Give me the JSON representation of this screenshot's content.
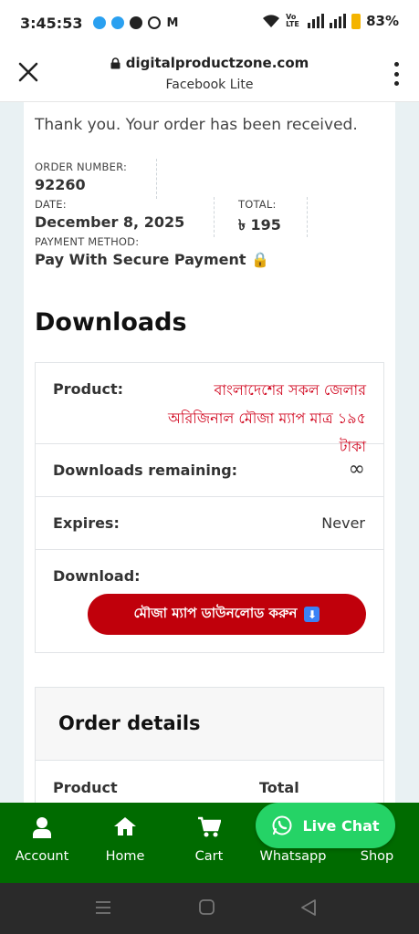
{
  "status_bar": {
    "time": "3:45:53",
    "network_label": "Vo LTE",
    "battery": "83%"
  },
  "browser": {
    "domain": "digitalproductzone.com",
    "subtitle": "Facebook Lite"
  },
  "order": {
    "thank_you": "Thank you. Your order has been received.",
    "number_label": "ORDER NUMBER:",
    "number": "92260",
    "date_label": "DATE:",
    "date": "December 8, 2025",
    "total_label": "TOTAL:",
    "total": "৳ 195",
    "payment_label": "PAYMENT METHOD:",
    "payment": "Pay With Secure Payment 🔒"
  },
  "downloads": {
    "title": "Downloads",
    "product_label": "Product:",
    "product_name": "বাংলাদেশের সকল জেলার অরিজিনাল মৌজা ম্যাপ মাত্র ১৯৫ টাকা",
    "remaining_label": "Downloads remaining:",
    "remaining_value": "∞",
    "expires_label": "Expires:",
    "expires_value": "Never",
    "download_label": "Download:",
    "download_button": "মৌজা ম্যাপ ডাউনলোড করুন",
    "download_icon": "⬇"
  },
  "order_details": {
    "title": "Order details",
    "col_product": "Product",
    "col_total": "Total"
  },
  "bottom_nav": {
    "items": [
      {
        "label": "Account",
        "icon": "user-icon"
      },
      {
        "label": "Home",
        "icon": "home-icon"
      },
      {
        "label": "Cart",
        "icon": "cart-icon"
      },
      {
        "label": "Whatsapp",
        "icon": "whatsapp-icon"
      },
      {
        "label": "Shop",
        "icon": "shop-icon"
      }
    ],
    "live_chat": "Live Chat"
  },
  "colors": {
    "nav_green": "#006b00",
    "whatsapp_green": "#25d366",
    "button_red": "#c0000b",
    "link_red": "#d0021b"
  }
}
